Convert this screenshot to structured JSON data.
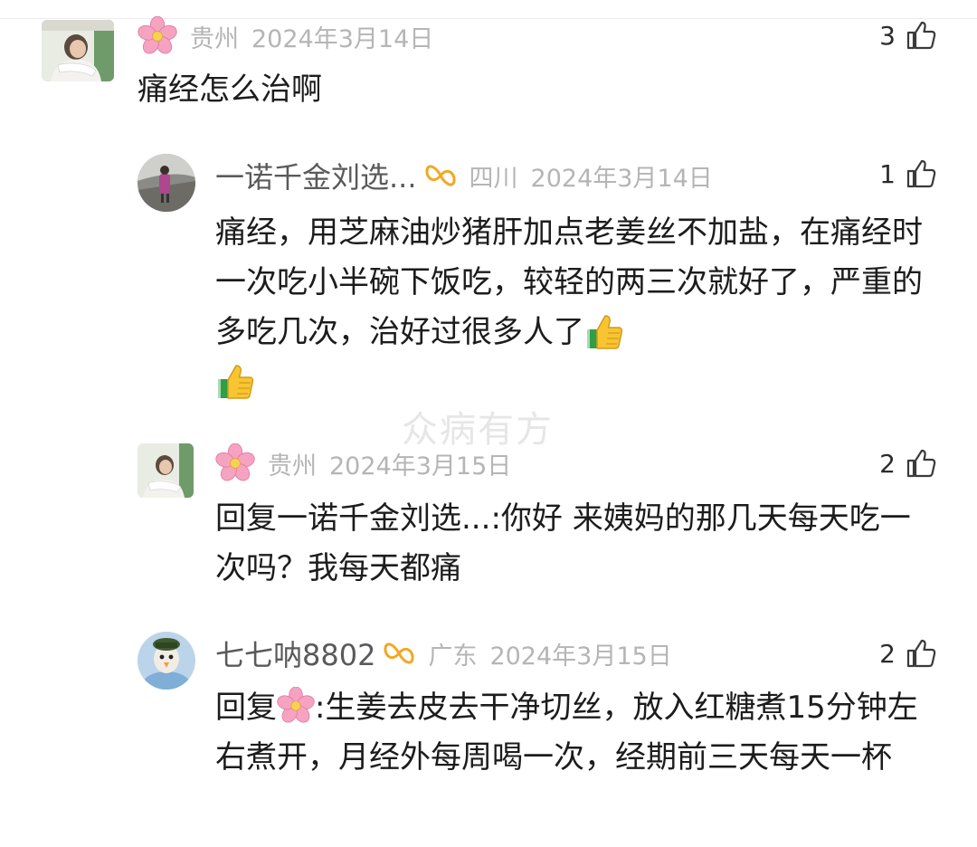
{
  "watermark": "众病有方",
  "comment1": {
    "icon": "flower-emoji",
    "region": "贵州",
    "date": "2024年3月14日",
    "likes": "3",
    "text": "痛经怎么治啊"
  },
  "reply1": {
    "name": "一诺千金刘选...",
    "region": "四川",
    "date": "2024年3月14日",
    "likes": "1",
    "text": "痛经，用芝麻油炒猪肝加点老姜丝不加盐，在痛经时一次吃小半碗下饭吃，较轻的两三次就好了，严重的多吃几次，治好过很多人了",
    "emojis": [
      "thumbs-up-emoji",
      "thumbs-up-emoji"
    ]
  },
  "reply2": {
    "icon": "flower-emoji",
    "region": "贵州",
    "date": "2024年3月15日",
    "likes": "2",
    "prefix": "回复",
    "mention": "一诺千金刘选...",
    "text": ":你好 来姨妈的那几天每天吃一次吗？我每天都痛"
  },
  "reply3": {
    "name": "七七呐8802",
    "region": "广东",
    "date": "2024年3月15日",
    "likes": "2",
    "prefix": "回复",
    "text": ":生姜去皮去干净切丝，放入红糖煮15分钟左右煮开，月经外每周喝一次，经期前三天每天一杯"
  },
  "colors": {
    "meta_gray": "#b5b5b5",
    "name_gray": "#5a5a5a",
    "text": "#1c1c1c",
    "flower_pink": "#f48fb1",
    "vip_orange": "#f5a623"
  }
}
